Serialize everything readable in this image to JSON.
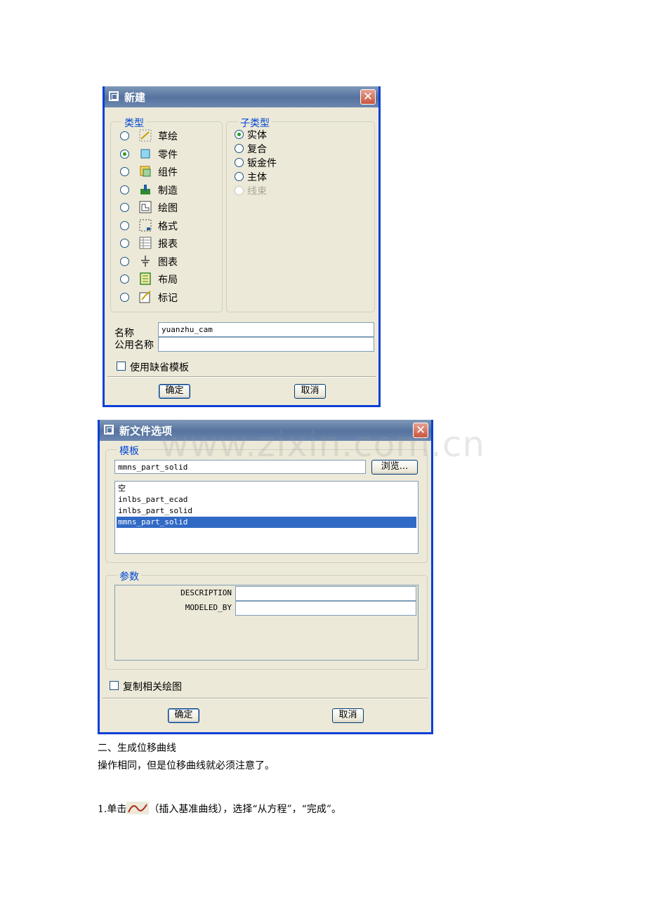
{
  "dialog1": {
    "title": "新建",
    "close": "✕",
    "type_group": {
      "legend": "类型",
      "items": [
        {
          "label": "草绘",
          "icon": "sketch-icon",
          "selected": false
        },
        {
          "label": "零件",
          "icon": "part-icon",
          "selected": true
        },
        {
          "label": "组件",
          "icon": "assembly-icon",
          "selected": false
        },
        {
          "label": "制造",
          "icon": "manufacturing-icon",
          "selected": false
        },
        {
          "label": "绘图",
          "icon": "drawing-icon",
          "selected": false
        },
        {
          "label": "格式",
          "icon": "format-icon",
          "selected": false
        },
        {
          "label": "报表",
          "icon": "report-icon",
          "selected": false
        },
        {
          "label": "图表",
          "icon": "diagram-icon",
          "selected": false
        },
        {
          "label": "布局",
          "icon": "layout-icon",
          "selected": false
        },
        {
          "label": "标记",
          "icon": "markup-icon",
          "selected": false
        }
      ]
    },
    "subtype_group": {
      "legend": "子类型",
      "items": [
        {
          "label": "实体",
          "selected": true,
          "disabled": false
        },
        {
          "label": "复合",
          "selected": false,
          "disabled": false
        },
        {
          "label": "钣金件",
          "selected": false,
          "disabled": false
        },
        {
          "label": "主体",
          "selected": false,
          "disabled": false
        },
        {
          "label": "线束",
          "selected": false,
          "disabled": true
        }
      ]
    },
    "name_label": "名称",
    "name_value": "yuanzhu_cam",
    "common_name_label": "公用名称",
    "common_name_value": "",
    "use_default_template_label": "使用缺省模板",
    "ok_label": "确定",
    "cancel_label": "取消"
  },
  "dialog2": {
    "title": "新文件选项",
    "close": "✕",
    "template_legend": "模板",
    "template_value": "mmns_part_solid",
    "browse_label": "浏览...",
    "template_list": [
      "空",
      "inlbs_part_ecad",
      "inlbs_part_solid",
      "mmns_part_solid"
    ],
    "selected_template_index": 3,
    "params_legend": "参数",
    "params": [
      {
        "name": "DESCRIPTION",
        "value": ""
      },
      {
        "name": "MODELED_BY",
        "value": ""
      }
    ],
    "copy_drawings_label": "复制相关绘图",
    "ok_label": "确定",
    "cancel_label": "取消"
  },
  "watermark": "www.zixin.com.cn",
  "document": {
    "heading": "二、生成位移曲线",
    "line1": "操作相同，但是位移曲线就必须注意了。",
    "step_prefix": "1.单击",
    "step_icon": "insert-datum-curve-icon",
    "step_suffix": "（插入基准曲线），选择“从方程”，“完成”。"
  },
  "colors": {
    "title_bar": "#6a86ad",
    "legend_text": "#0046d5",
    "selection": "#316ac5",
    "radio_dot": "#21a121"
  }
}
